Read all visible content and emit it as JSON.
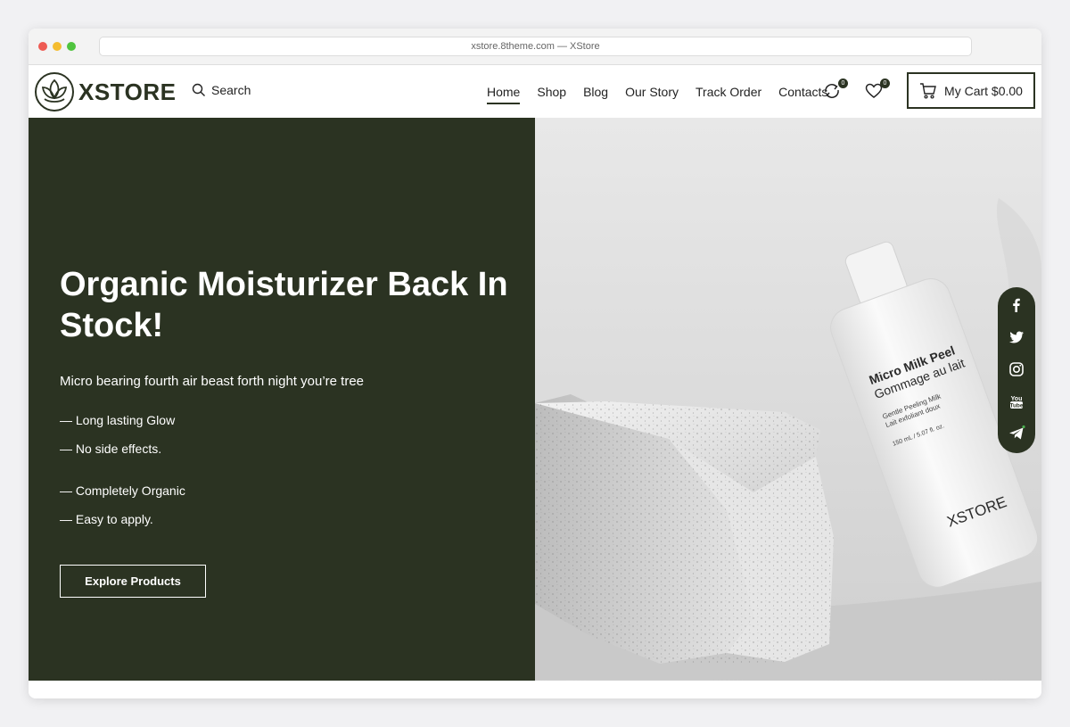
{
  "browser": {
    "url": "xstore.8theme.com — XStore"
  },
  "header": {
    "logo_text": "XSTORE",
    "search_label": "Search",
    "nav": [
      {
        "label": "Home",
        "active": true
      },
      {
        "label": "Shop",
        "active": false
      },
      {
        "label": "Blog",
        "active": false
      },
      {
        "label": "Our Story",
        "active": false
      },
      {
        "label": "Track Order",
        "active": false
      },
      {
        "label": "Contacts",
        "active": false
      }
    ],
    "compare_count": "0",
    "wishlist_count": "0",
    "cart_label": "My Cart $0.00"
  },
  "hero": {
    "title": "Organic Moisturizer Back In Stock!",
    "subtitle": "Micro bearing fourth air beast forth night you’re tree",
    "features": [
      "— Long lasting Glow",
      "— No side effects.",
      "— Completely Organic",
      "— Easy to apply."
    ],
    "cta_label": "Explore Products",
    "product": {
      "name": "Micro Milk Peel",
      "name_fr": "Gommage au lait",
      "desc_en": "Gentle Peeling Milk",
      "desc_fr": "Lait exfoliant doux",
      "volume": "150 mL / 5.07 fl. oz.",
      "brand": "XSTORE"
    }
  },
  "social": {
    "icons": [
      "facebook-icon",
      "twitter-icon",
      "instagram-icon",
      "youtube-icon",
      "telegram-icon"
    ],
    "youtube_label": "You Tube"
  },
  "colors": {
    "brand_dark": "#2b3322",
    "hero_text": "#ffffff"
  }
}
